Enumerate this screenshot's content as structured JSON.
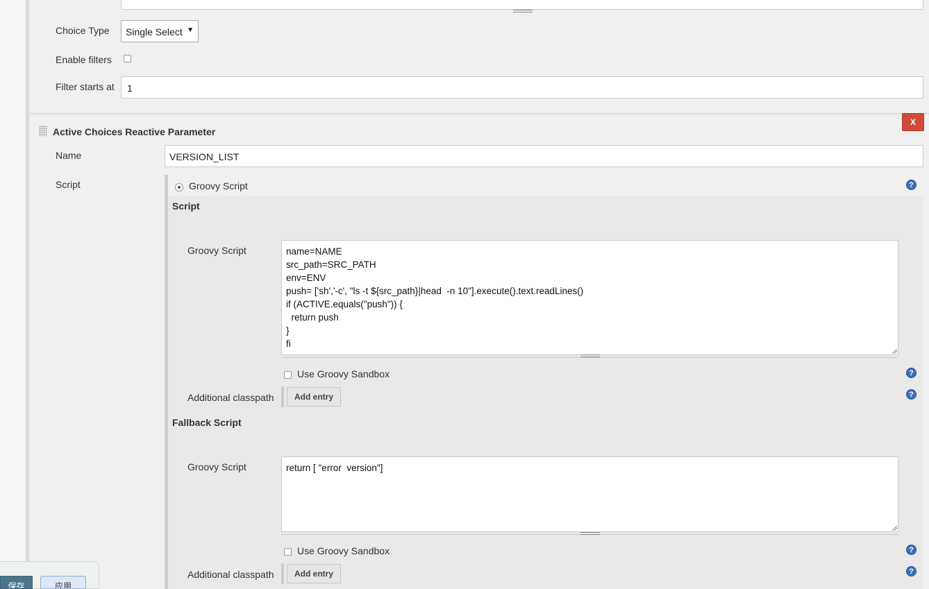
{
  "top_param": {
    "choice_type_label": "Choice Type",
    "choice_type_value": "Single Select",
    "enable_filters_label": "Enable filters",
    "filter_starts_label": "Filter starts at",
    "filter_starts_value": "1"
  },
  "reactive_param": {
    "title": "Active Choices Reactive Parameter",
    "delete_label": "X",
    "name_label": "Name",
    "name_value": "VERSION_LIST",
    "script_label": "Script",
    "groovy_radio_label": "Groovy Script",
    "script_section": {
      "heading": "Script",
      "groovy_label": "Groovy Script",
      "code": "name=NAME\nsrc_path=SRC_PATH\nenv=ENV\npush= ['sh','-c', \"ls -t ${src_path}|head  -n 10\"].execute().text.readLines()\nif (ACTIVE.equals(\"push\")) {\n  return push\n}\nfi",
      "sandbox_label": "Use Groovy Sandbox",
      "classpath_label": "Additional classpath",
      "add_entry_label": "Add entry"
    },
    "fallback_section": {
      "heading": "Fallback Script",
      "groovy_label": "Groovy Script",
      "code": "return [ \"error  version\"]",
      "sandbox_label": "Use Groovy Sandbox",
      "classpath_label": "Additional classpath",
      "add_entry_label": "Add entry"
    }
  },
  "bottom_bar": {
    "save_label": "保存",
    "apply_label": "应用"
  },
  "help_symbol": "?"
}
